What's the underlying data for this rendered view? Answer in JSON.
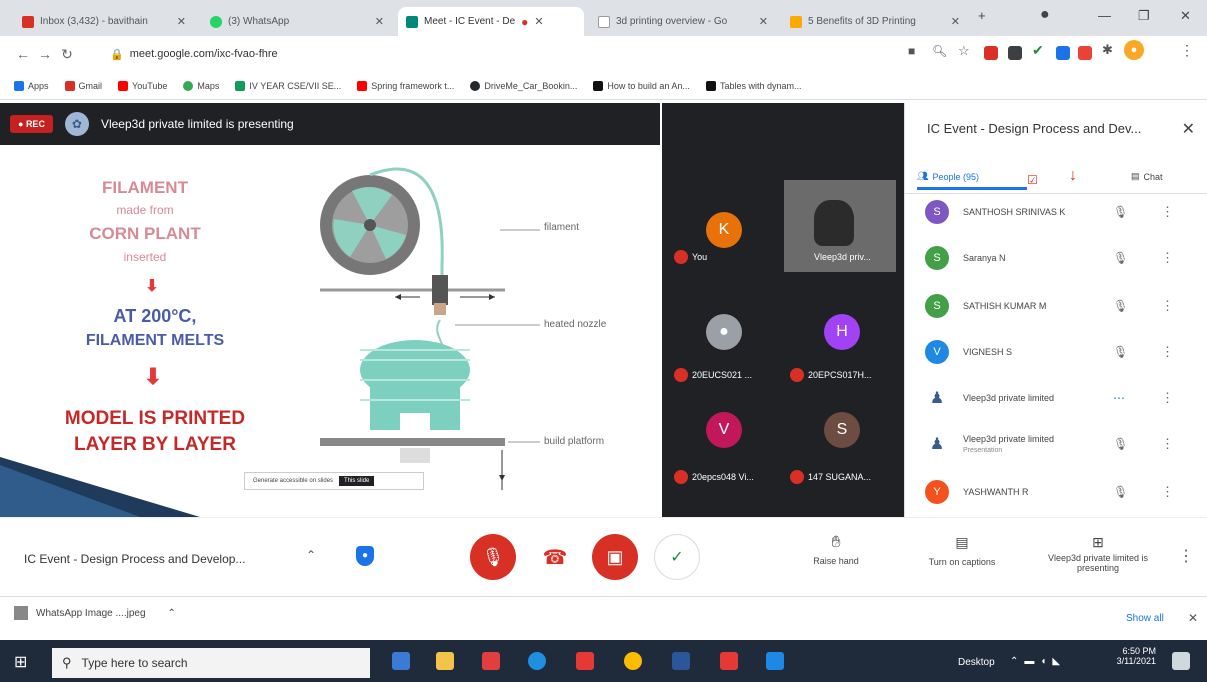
{
  "browser": {
    "tabs": [
      {
        "title": "Inbox (3,432) - bavithain",
        "active": false
      },
      {
        "title": "(3) WhatsApp",
        "active": false
      },
      {
        "title": "Meet - IC Event - De",
        "active": true
      },
      {
        "title": "3d printing overview - Go",
        "active": false
      },
      {
        "title": "5 Benefits of 3D Printing",
        "active": false
      }
    ],
    "new_tab": "+",
    "url": "meet.google.com/ixc-fvao-fhre",
    "bookmarks": [
      "Apps",
      "Gmail",
      "YouTube",
      "Maps",
      "IV YEAR CSE/VII SE...",
      "Spring framework t...",
      "DriveMe_Car_Bookin...",
      "How to build an An...",
      "Tables with dynam..."
    ]
  },
  "meet": {
    "rec_label": "REC",
    "presenting": "Vleep3d private limited is presenting",
    "slide": {
      "line1": "FILAMENT",
      "line2": "made from",
      "line3": "CORN PLANT",
      "line4": "inserted",
      "line5": "AT 200°C,",
      "line6": "FILAMENT MELTS",
      "line7": "MODEL IS PRINTED",
      "line8": "LAYER BY LAYER",
      "label_filament": "filament",
      "label_nozzle": "heated nozzle",
      "label_platform": "build platform",
      "caption_bar": "Generate accessible on slides",
      "caption_btn": "This slide"
    },
    "tiles": [
      {
        "initial": "K",
        "name": "You",
        "color": "#e8710a"
      },
      {
        "initial": "",
        "name": "Vleep3d priv...",
        "color": "#5f6368"
      },
      {
        "initial": "",
        "name": "20EUCS021 ...",
        "color": "#9aa0a6"
      },
      {
        "initial": "H",
        "name": "20EPCS017H...",
        "color": "#a142f4"
      },
      {
        "initial": "V",
        "name": "20epcs048 Vi...",
        "color": "#c2185b"
      },
      {
        "initial": "S",
        "name": "147 SUGANA...",
        "color": "#6d4c41"
      }
    ],
    "panel": {
      "title": "IC Event - Design Process and Dev...",
      "people_tab": "People (95)",
      "chat_tab": "Chat",
      "people": [
        {
          "initial": "S",
          "name": "SANTHOSH SRINIVAS K",
          "color": "#7e57c2"
        },
        {
          "initial": "S",
          "name": "Saranya N",
          "color": "#43a047"
        },
        {
          "initial": "S",
          "name": "SATHISH KUMAR M",
          "color": "#43a047"
        },
        {
          "initial": "V",
          "name": "VIGNESH S",
          "color": "#1e88e5"
        },
        {
          "initial": "",
          "name": "Vleep3d private limited",
          "color": "#ffffff"
        },
        {
          "initial": "",
          "name": "Vleep3d private limited",
          "sub": "Presentation",
          "color": "#ffffff"
        },
        {
          "initial": "Y",
          "name": "YASHWANTH R",
          "color": "#f4511e"
        }
      ]
    },
    "bottom": {
      "meeting_name": "IC Event - Design Process and Develop...",
      "raise_hand": "Raise hand",
      "captions": "Turn on captions",
      "presenting": "Vleep3d private limited is presenting"
    }
  },
  "download": {
    "file": "WhatsApp Image ....jpeg",
    "show_all": "Show all"
  },
  "taskbar": {
    "search_placeholder": "Type here to search",
    "desktop": "Desktop",
    "time": "6:50 PM",
    "date": "3/11/2021"
  },
  "colors": {
    "accent": "#1a73e8",
    "red": "#d93025",
    "dark": "#202124"
  }
}
